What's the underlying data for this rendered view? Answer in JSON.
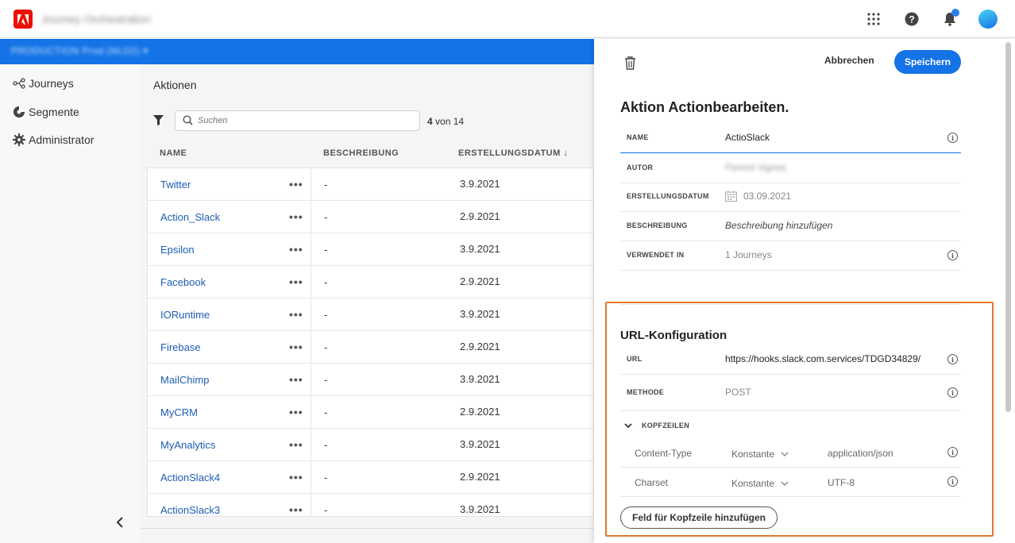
{
  "topbar": {
    "app_title": "Journey Orchestration"
  },
  "sandbox": {
    "label": "PRODUCTION  Prod (NLD2)  ▾"
  },
  "leftnav": {
    "items": [
      {
        "label": "Journeys"
      },
      {
        "label": "Segmente"
      },
      {
        "label": "Administrator"
      }
    ]
  },
  "main": {
    "title": "Aktionen",
    "search_placeholder": "Suchen",
    "count_num": "4",
    "count_text": "von 14",
    "columns": {
      "name": "NAME",
      "description": "BESCHREIBUNG",
      "created": "ERSTELLUNGSDATUM",
      "sort_arrow": "↓"
    },
    "rows": [
      {
        "name": "Twitter",
        "desc": "-",
        "date": "3.9.2021"
      },
      {
        "name": "Action_Slack",
        "desc": "-",
        "date": "2.9.2021"
      },
      {
        "name": "Epsilon",
        "desc": "-",
        "date": "3.9.2021"
      },
      {
        "name": "Facebook",
        "desc": "-",
        "date": "2.9.2021"
      },
      {
        "name": "IORuntime",
        "desc": "-",
        "date": "3.9.2021"
      },
      {
        "name": "Firebase",
        "desc": "-",
        "date": "2.9.2021"
      },
      {
        "name": "MailChimp",
        "desc": "-",
        "date": "3.9.2021"
      },
      {
        "name": "MyCRM",
        "desc": "-",
        "date": "2.9.2021"
      },
      {
        "name": "MyAnalytics",
        "desc": "-",
        "date": "3.9.2021"
      },
      {
        "name": "ActionSlack4",
        "desc": "-",
        "date": "2.9.2021"
      },
      {
        "name": "ActionSlack3",
        "desc": "-",
        "date": "3.9.2021"
      }
    ],
    "more": "•••"
  },
  "panel": {
    "cancel_label": "Abbrechen",
    "save_label": "Speichern",
    "title": "Aktion Actionbearbeiten.",
    "fields": {
      "name_label": "NAME",
      "name_value": "ActioSlack",
      "author_label": "AUTOR",
      "author_value": "Florent Vignes",
      "created_label": "ERSTELLUNGSDATUM",
      "created_value": "03.09.2021",
      "desc_label": "BESCHREIBUNG",
      "desc_value": "Beschreibung hinzufügen",
      "used_label": "VERWENDET IN",
      "used_value": "1 Journeys"
    },
    "url_config": {
      "title": "URL-Konfiguration",
      "url_label": "URL",
      "url_value": "https://hooks.slack.com.services/TDGD34829/",
      "method_label": "METHODE",
      "method_value": "POST",
      "headers_label": "KOPFZEILEN",
      "headers": [
        {
          "key": "Content-Type",
          "type": "Konstante",
          "value": "application/json"
        },
        {
          "key": "Charset",
          "type": "Konstante",
          "value": "UTF-8"
        }
      ],
      "add_header_label": "Feld für Kopfzeile hinzufügen"
    },
    "highlight_color": "#e0782e"
  },
  "colors": {
    "accent": "#1473e6",
    "link": "#1d5db5",
    "adobe_red": "#eb1000"
  }
}
